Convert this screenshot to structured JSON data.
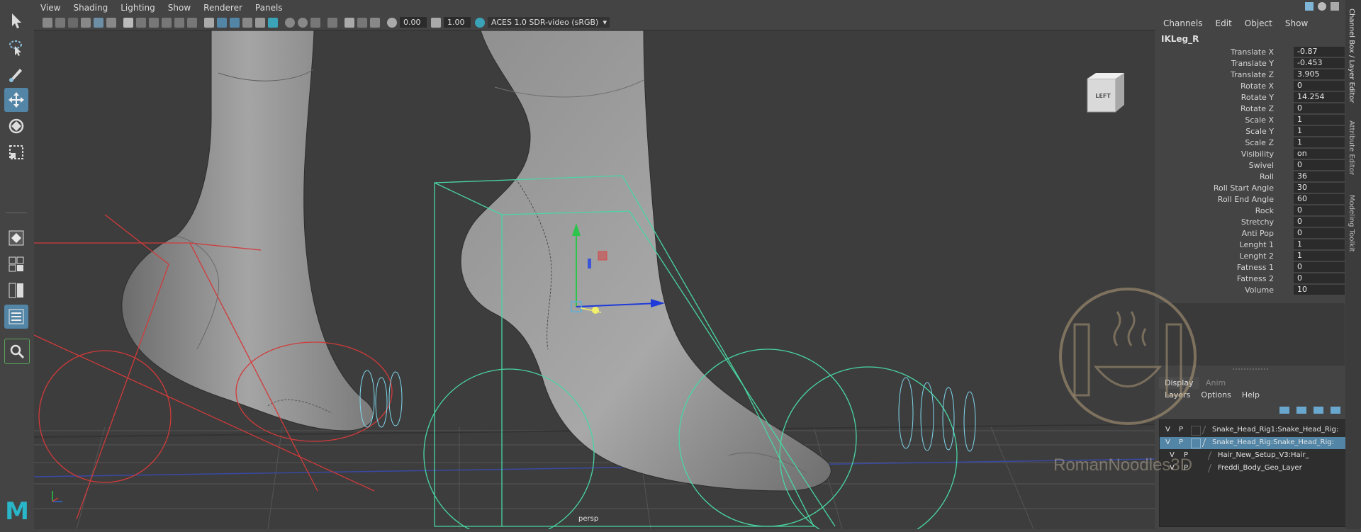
{
  "menubar": [
    "View",
    "Shading",
    "Lighting",
    "Show",
    "Renderer",
    "Panels"
  ],
  "viewport_toolbar": {
    "field_a": "0.00",
    "field_b": "1.00",
    "color_space": "ACES 1.0 SDR-video (sRGB)"
  },
  "viewcube_label": "LEFT",
  "camera_label": "persp",
  "app_logo": "M",
  "channel_box": {
    "menu": [
      "Channels",
      "Edit",
      "Object",
      "Show"
    ],
    "object_name": "IKLeg_R",
    "attributes": [
      {
        "label": "Translate X",
        "value": "-0.87"
      },
      {
        "label": "Translate Y",
        "value": "-0.453"
      },
      {
        "label": "Translate Z",
        "value": "3.905"
      },
      {
        "label": "Rotate X",
        "value": "0"
      },
      {
        "label": "Rotate Y",
        "value": "14.254"
      },
      {
        "label": "Rotate Z",
        "value": "0"
      },
      {
        "label": "Scale X",
        "value": "1"
      },
      {
        "label": "Scale Y",
        "value": "1"
      },
      {
        "label": "Scale Z",
        "value": "1"
      },
      {
        "label": "Visibility",
        "value": "on"
      },
      {
        "label": "Swivel",
        "value": "0"
      },
      {
        "label": "Roll",
        "value": "36"
      },
      {
        "label": "Roll Start Angle",
        "value": "30"
      },
      {
        "label": "Roll End Angle",
        "value": "60"
      },
      {
        "label": "Rock",
        "value": "0"
      },
      {
        "label": "Stretchy",
        "value": "0"
      },
      {
        "label": "Anti Pop",
        "value": "0"
      },
      {
        "label": "Lenght 1",
        "value": "1"
      },
      {
        "label": "Lenght 2",
        "value": "1"
      },
      {
        "label": "Fatness 1",
        "value": "0"
      },
      {
        "label": "Fatness 2",
        "value": "0"
      },
      {
        "label": "Volume",
        "value": "10"
      }
    ]
  },
  "layer_editor": {
    "tabs": [
      "Display",
      "Anim"
    ],
    "menu": [
      "Layers",
      "Options",
      "Help"
    ],
    "layers": [
      {
        "v": "V",
        "p": "P",
        "name": "Snake_Head_Rig1:Snake_Head_Rig:",
        "selected": false
      },
      {
        "v": "V",
        "p": "P",
        "name": "Snake_Head_Rig:Snake_Head_Rig:",
        "selected": true
      },
      {
        "v": "V",
        "p": "P",
        "name": "Hair_New_Setup_V3:Hair_",
        "selected": false
      },
      {
        "v": "V",
        "p": "P",
        "name": "Freddi_Body_Geo_Layer",
        "selected": false
      }
    ]
  },
  "side_tabs": [
    "Channel Box / Layer Editor",
    "Attribute Editor",
    "Modeling Toolkit"
  ],
  "watermark_text": "RomanNoodles3D",
  "colors": {
    "accent": "#5285a6",
    "rig_red": "#d23a3a",
    "control_green": "#49d6a3",
    "control_blue": "#7fd8ee"
  }
}
